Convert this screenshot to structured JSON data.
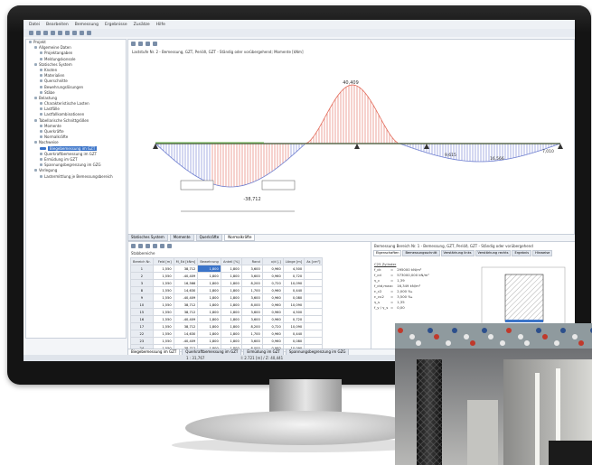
{
  "menu": [
    "Datei",
    "Bearbeiten",
    "Bemessung",
    "Ergebnisse",
    "Zusätze",
    "Hilfe"
  ],
  "navigator": [
    {
      "label": "Projekt",
      "selected": false
    },
    {
      "label": "Allgemeine Daten",
      "selected": false
    },
    {
      "label": "Projektangaben",
      "selected": false
    },
    {
      "label": "Meldungskonsole",
      "selected": false
    },
    {
      "label": "Statisches System",
      "selected": false
    },
    {
      "label": "Knoten",
      "selected": false
    },
    {
      "label": "Materialien",
      "selected": false
    },
    {
      "label": "Querschnitte",
      "selected": false
    },
    {
      "label": "Bewehrungslösungen",
      "selected": false
    },
    {
      "label": "Stäbe",
      "selected": false
    },
    {
      "label": "Belastung",
      "selected": false
    },
    {
      "label": "Charakteristische Lasten",
      "selected": false
    },
    {
      "label": "Lastfälle",
      "selected": false
    },
    {
      "label": "Lastfallkombinationen",
      "selected": false
    },
    {
      "label": "Tabellarische Schnittgrößen",
      "selected": false
    },
    {
      "label": "Momente",
      "selected": false
    },
    {
      "label": "Querkräfte",
      "selected": false
    },
    {
      "label": "Normalkräfte",
      "selected": false
    },
    {
      "label": "Nachweise",
      "selected": false
    },
    {
      "label": "Biegebemessung im GZT",
      "selected": true
    },
    {
      "label": "Querkraftbemessung im GZT",
      "selected": false
    },
    {
      "label": "Ermüdung im GZT",
      "selected": false
    },
    {
      "label": "Spannungsbegrenzung im GZG",
      "selected": false
    },
    {
      "label": "Verlegung",
      "selected": false
    },
    {
      "label": "Lastermittlung je Bemessungsbereich",
      "selected": false
    }
  ],
  "graphic": {
    "caption": "Laststufe Nr. 2 - Bemessung, GZT, Perióð, GZT - Ständig oder vorübergehend; Momente [kNm]",
    "labels": {
      "max_positive": "40,409",
      "max_negative": "-38,712",
      "right_a": "9,615",
      "right_b": "16,566",
      "right_c": "7,010"
    },
    "tabs": [
      "Statisches System",
      "Momente",
      "Querkräfte",
      "Normalkräfte"
    ],
    "active_tab": "Normalkräfte"
  },
  "results": {
    "title": "Stabbereiche",
    "columns": [
      "Bereich Nr.",
      "Feld [m]",
      "M_Ed [kNm]",
      "Bewehrung",
      "Anteil [%]",
      "Rand",
      "x/d [-]",
      "Länge [m]",
      "As [cm²]",
      "ρ [%]"
    ],
    "rows": [
      [
        "1",
        "1,550",
        "38,712",
        "1,800",
        "1,800",
        "3,600",
        "0,960",
        "4,500"
      ],
      [
        "2",
        "1,550",
        "-40,409",
        "1,800",
        "1,800",
        "3,600",
        "0,960",
        "0,720"
      ],
      [
        "3",
        "1,550",
        "16,566",
        "1,800",
        "1,800",
        "8,200",
        "0,720",
        "10,090"
      ],
      [
        "8",
        "1,550",
        "14,630",
        "1,800",
        "1,800",
        "1,700",
        "0,960",
        "0,440"
      ],
      [
        "9",
        "1,550",
        "-40,409",
        "1,800",
        "1,800",
        "3,600",
        "0,960",
        "0,080"
      ],
      [
        "10",
        "1,550",
        "38,712",
        "1,800",
        "1,800",
        "8,000",
        "0,960",
        "10,090"
      ],
      [
        "15",
        "1,550",
        "38,712",
        "1,800",
        "1,800",
        "3,600",
        "0,960",
        "4,500"
      ],
      [
        "16",
        "1,550",
        "-40,409",
        "1,800",
        "1,800",
        "3,600",
        "0,960",
        "0,720"
      ],
      [
        "17",
        "1,550",
        "38,712",
        "1,800",
        "1,800",
        "8,200",
        "0,720",
        "10,090"
      ],
      [
        "22",
        "1,550",
        "14,630",
        "1,800",
        "1,800",
        "1,700",
        "0,960",
        "0,440"
      ],
      [
        "23",
        "1,550",
        "-40,409",
        "1,800",
        "1,800",
        "3,600",
        "0,960",
        "0,080"
      ],
      [
        "24",
        "1,550",
        "38,712",
        "1,800",
        "1,800",
        "8,000",
        "0,960",
        "10,090"
      ]
    ],
    "highlight_row": 0
  },
  "detail": {
    "title": "Bemessung Bereich Nr. 1 - Bemessung, GZT, Perióð, GZT - Ständig oder vorübergehend",
    "tabs": [
      "Eigenschaften",
      "Bemessungsschnitt",
      "Verstärkung links",
      "Verstärkung rechts",
      "Ergebnis",
      "Hinweise"
    ],
    "active_tab": "Eigenschaften",
    "section": "C25 Zylinder",
    "params": [
      [
        "f_ck",
        "=",
        "295000 kN/m²"
      ],
      [
        "f_cd",
        "=",
        "573000,000 kN/m²"
      ],
      [
        "γ_c",
        "=",
        "1,39"
      ],
      [
        "f_ctd,max",
        "=",
        "16,349 kN/m²"
      ],
      [
        "ε_c2",
        "=",
        "2,000 ‰"
      ],
      [
        "ε_cu2",
        "=",
        "3,500 ‰"
      ],
      [
        "γ_s",
        "=",
        "1,35"
      ],
      [
        "f_y / γ_s",
        "=",
        "0,00"
      ]
    ]
  },
  "bottom_tabs": [
    "Biegebemessung im GZT",
    "Querkraftbemessung im GZT",
    "Ermüdung im GZT",
    "Spannungsbegrenzung im GZG"
  ],
  "status": [
    "1 : 31,767",
    "I: 2.721 [m] / Z: 40,441"
  ],
  "photo_caption": "",
  "colors": {
    "moment_pos": "#e36b5a",
    "moment_neg": "#6f7fd0",
    "beam": "#5b6b4f",
    "accent": "#3b74c9"
  }
}
